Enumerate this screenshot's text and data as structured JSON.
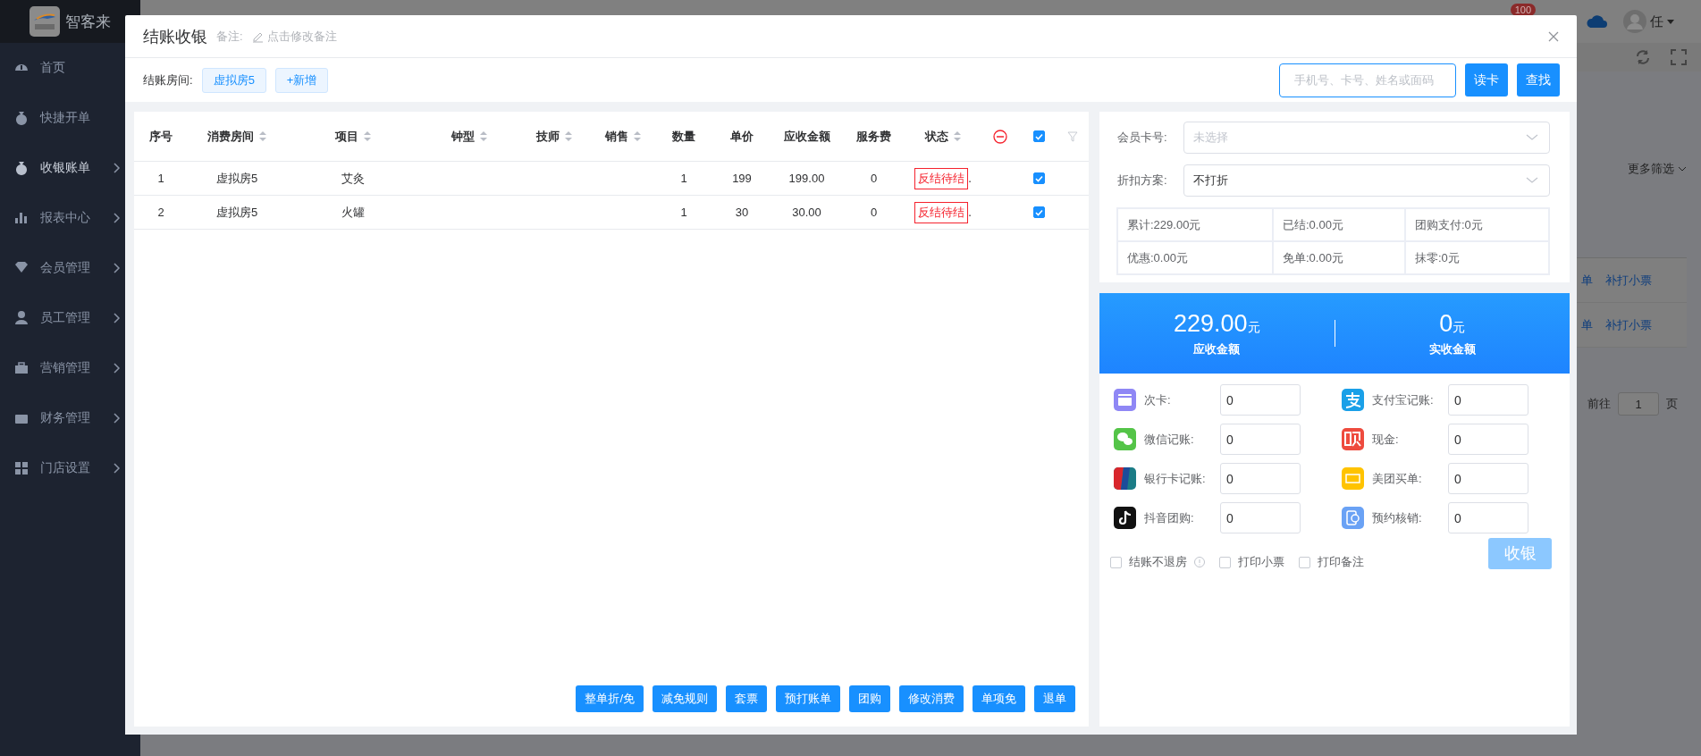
{
  "sidebar": {
    "brand": "智客来",
    "items": [
      {
        "label": "首页",
        "expandable": false,
        "selected": false
      },
      {
        "label": "快捷开单",
        "expandable": false,
        "selected": false
      },
      {
        "label": "收银账单",
        "expandable": true,
        "selected": true
      },
      {
        "label": "报表中心",
        "expandable": true,
        "selected": false
      },
      {
        "label": "会员管理",
        "expandable": true,
        "selected": false
      },
      {
        "label": "员工管理",
        "expandable": true,
        "selected": false
      },
      {
        "label": "营销管理",
        "expandable": true,
        "selected": false
      },
      {
        "label": "财务管理",
        "expandable": true,
        "selected": false
      },
      {
        "label": "门店设置",
        "expandable": true,
        "selected": false
      }
    ]
  },
  "topbar": {
    "badge": "100",
    "user": "任"
  },
  "background": {
    "filter_link": "更多筛选",
    "rows": [
      {
        "column_1": "单",
        "column_2": "补打小票"
      },
      {
        "column_1": "单",
        "column_2": "补打小票"
      }
    ],
    "pager": {
      "label": "前往",
      "page": "1",
      "unit": "页"
    }
  },
  "modal": {
    "title": "结账收银",
    "note_label": "备注:",
    "note_link": "点击修改备注",
    "room_label": "结账房间:",
    "rooms": [
      {
        "label": "虚拟房5"
      }
    ],
    "add_room": "+新增",
    "search": {
      "placeholder": "手机号、卡号、姓名或面码"
    },
    "search_buttons": [
      "读卡",
      "查找"
    ]
  },
  "table": {
    "columns": [
      {
        "label": "序号",
        "sortable": false
      },
      {
        "label": "消费房间",
        "sortable": true
      },
      {
        "label": "项目",
        "sortable": true
      },
      {
        "label": "钟型",
        "sortable": true
      },
      {
        "label": "技师",
        "sortable": true
      },
      {
        "label": "销售",
        "sortable": true
      },
      {
        "label": "数量",
        "sortable": false
      },
      {
        "label": "单价",
        "sortable": false
      },
      {
        "label": "应收金额",
        "sortable": false
      },
      {
        "label": "服务费",
        "sortable": false
      },
      {
        "label": "状态",
        "sortable": true
      }
    ],
    "select_all": true,
    "rows": [
      {
        "index": "1",
        "room": "虚拟房5",
        "item": "艾灸",
        "quantity": "1",
        "price": "199",
        "amount": "199.00",
        "service_fee": "0",
        "status": "反结待结",
        "status_suffix": ".",
        "checked": true
      },
      {
        "index": "2",
        "room": "虚拟房5",
        "item": "火罐",
        "quantity": "1",
        "price": "30",
        "amount": "30.00",
        "service_fee": "0",
        "status": "反结待结",
        "status_suffix": ".",
        "checked": true
      }
    ]
  },
  "actions": [
    "整单折/免",
    "减免规则",
    "套票",
    "预打账单",
    "团购",
    "修改消费",
    "单项免",
    "退单"
  ],
  "member_card": {
    "label": "会员卡号:",
    "placeholder": "未选择"
  },
  "discount": {
    "label": "折扣方案:",
    "value": "不打折"
  },
  "summary": [
    {
      "label": "累计:",
      "value": "229.00元"
    },
    {
      "label": "已结:",
      "value": "0.00元"
    },
    {
      "label": "团购支付:",
      "value": "0元"
    },
    {
      "label": "优惠:",
      "value": "0.00元"
    },
    {
      "label": "免单:",
      "value": "0.00元"
    },
    {
      "label": "抹零:",
      "value": "0元"
    }
  ],
  "totals": [
    {
      "amount": "229.00",
      "unit": "元",
      "label": "应收金额"
    },
    {
      "amount": "0",
      "unit": "元",
      "label": "实收金额"
    }
  ],
  "payments": [
    {
      "label": "次卡:",
      "value": "0"
    },
    {
      "label": "支付宝记账:",
      "value": "0"
    },
    {
      "label": "微信记账:",
      "value": "0"
    },
    {
      "label": "现金:",
      "value": "0"
    },
    {
      "label": "银行卡记账:",
      "value": "0"
    },
    {
      "label": "美团买单:",
      "value": "0"
    },
    {
      "label": "抖音团购:",
      "value": "0"
    },
    {
      "label": "预约核销:",
      "value": "0"
    }
  ],
  "options": [
    {
      "label": "结账不退房",
      "checked": false,
      "info": true
    },
    {
      "label": "打印小票",
      "checked": false,
      "info": false
    },
    {
      "label": "打印备注",
      "checked": false,
      "info": false
    }
  ],
  "submit": {
    "label": "收银",
    "disabled": true
  }
}
